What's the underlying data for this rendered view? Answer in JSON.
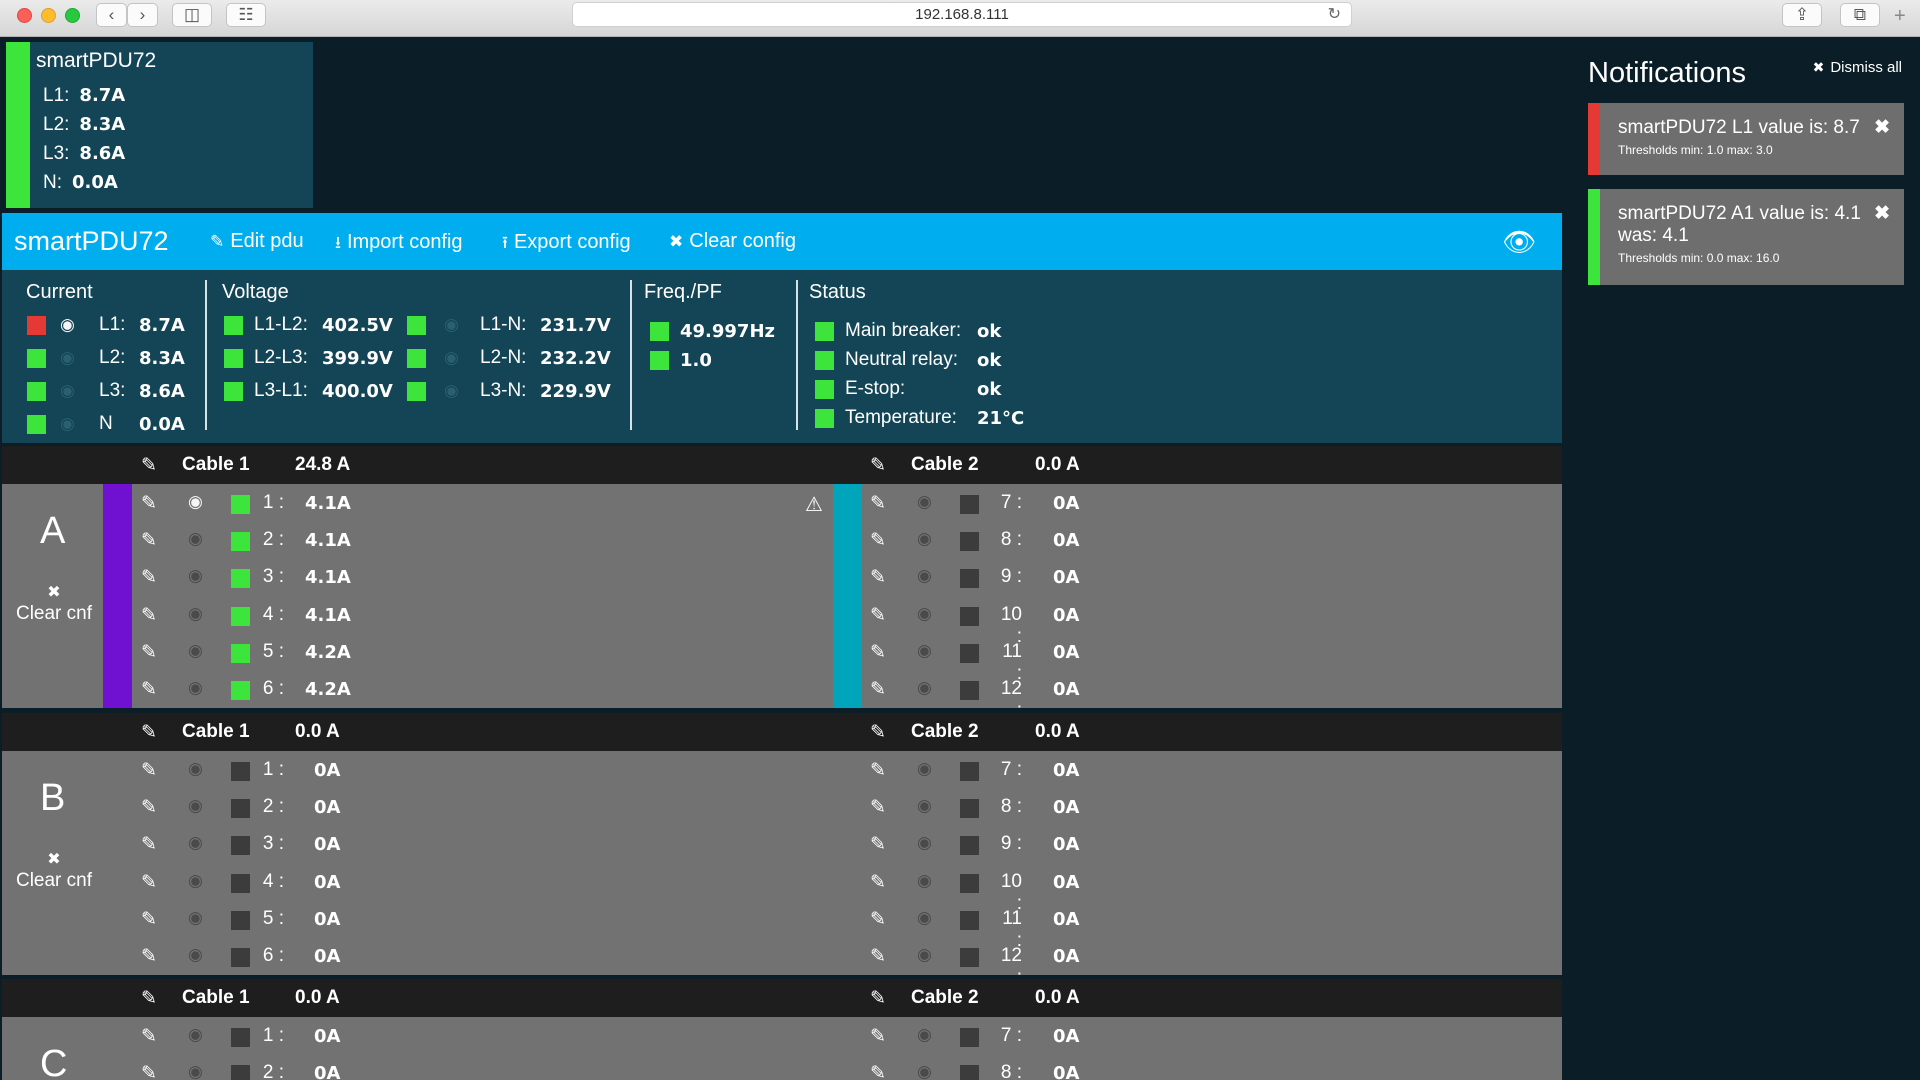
{
  "browser": {
    "url": "192.168.8.111",
    "nav_back_icon": "chevron-left-icon",
    "nav_forward_icon": "chevron-right-icon"
  },
  "mini_summary": {
    "title": "smartPDU72",
    "rows": [
      {
        "label": "L1:",
        "value": "8.7A"
      },
      {
        "label": "L2:",
        "value": "8.3A"
      },
      {
        "label": "L3:",
        "value": "8.6A"
      },
      {
        "label": "N:",
        "value": "0.0A"
      }
    ]
  },
  "header": {
    "pdu_name": "smartPDU72",
    "edit_pdu": "Edit pdu",
    "import_config": "Import config",
    "export_config": "Export config",
    "clear_config": "Clear config"
  },
  "metrics": {
    "current": {
      "heading": "Current",
      "rows": [
        {
          "label": "L1:",
          "value": "8.7A",
          "status": "red"
        },
        {
          "label": "L2:",
          "value": "8.3A",
          "status": "green"
        },
        {
          "label": "L3:",
          "value": "8.6A",
          "status": "green"
        },
        {
          "label": "N",
          "value": "0.0A",
          "status": "green"
        }
      ]
    },
    "voltage": {
      "heading": "Voltage",
      "line_to_line": [
        {
          "label": "L1-L2:",
          "value": "402.5V"
        },
        {
          "label": "L2-L3:",
          "value": "399.9V"
        },
        {
          "label": "L3-L1:",
          "value": "400.0V"
        }
      ],
      "line_to_neutral": [
        {
          "label": "L1-N:",
          "value": "231.7V"
        },
        {
          "label": "L2-N:",
          "value": "232.2V"
        },
        {
          "label": "L3-N:",
          "value": "229.9V"
        }
      ]
    },
    "freq_pf": {
      "heading": "Freq./PF",
      "frequency": "49.997Hz",
      "power_factor": "1.0"
    },
    "status": {
      "heading": "Status",
      "rows": [
        {
          "label": "Main breaker:",
          "value": "ok"
        },
        {
          "label": "Neutral relay:",
          "value": "ok"
        },
        {
          "label": "E-stop:",
          "value": "ok"
        },
        {
          "label": "Temperature:",
          "value": "21°C"
        }
      ]
    }
  },
  "segments": {
    "A": {
      "letter": "A",
      "clear_label": "Clear cnf",
      "cable1": {
        "label": "Cable 1",
        "value": "24.8 A",
        "stripe": "#7010d0"
      },
      "cable2": {
        "label": "Cable 2",
        "value": "0.0 A",
        "stripe": "#00a4bb"
      },
      "left": [
        {
          "num": "1 :",
          "value": "4.1A"
        },
        {
          "num": "2 :",
          "value": "4.1A"
        },
        {
          "num": "3 :",
          "value": "4.1A"
        },
        {
          "num": "4 :",
          "value": "4.1A"
        },
        {
          "num": "5 :",
          "value": "4.2A"
        },
        {
          "num": "6 :",
          "value": "4.2A"
        }
      ],
      "right": [
        {
          "num": "7 :",
          "value": "0A"
        },
        {
          "num": "8 :",
          "value": "0A"
        },
        {
          "num": "9 :",
          "value": "0A"
        },
        {
          "num": "10 :",
          "value": "0A"
        },
        {
          "num": "11 :",
          "value": "0A"
        },
        {
          "num": "12 :",
          "value": "0A"
        }
      ]
    },
    "B": {
      "letter": "B",
      "clear_label": "Clear cnf",
      "cable1": {
        "label": "Cable 1",
        "value": "0.0 A"
      },
      "cable2": {
        "label": "Cable 2",
        "value": "0.0 A"
      },
      "left": [
        {
          "num": "1 :",
          "value": "0A"
        },
        {
          "num": "2 :",
          "value": "0A"
        },
        {
          "num": "3 :",
          "value": "0A"
        },
        {
          "num": "4 :",
          "value": "0A"
        },
        {
          "num": "5 :",
          "value": "0A"
        },
        {
          "num": "6 :",
          "value": "0A"
        }
      ],
      "right": [
        {
          "num": "7 :",
          "value": "0A"
        },
        {
          "num": "8 :",
          "value": "0A"
        },
        {
          "num": "9 :",
          "value": "0A"
        },
        {
          "num": "10 :",
          "value": "0A"
        },
        {
          "num": "11 :",
          "value": "0A"
        },
        {
          "num": "12 :",
          "value": "0A"
        }
      ]
    },
    "C": {
      "letter": "C",
      "cable1": {
        "label": "Cable 1",
        "value": "0.0 A"
      },
      "cable2": {
        "label": "Cable 2",
        "value": "0.0 A"
      },
      "left": [
        {
          "num": "1 :",
          "value": "0A"
        },
        {
          "num": "2 :",
          "value": "0A"
        }
      ],
      "right": [
        {
          "num": "7 :",
          "value": "0A"
        },
        {
          "num": "8 :",
          "value": "0A"
        }
      ]
    }
  },
  "notifications": {
    "title": "Notifications",
    "dismiss_all": "Dismiss all",
    "items": [
      {
        "text": "smartPDU72 L1 value is: 8.7",
        "thresholds": "Thresholds min: 1.0 max: 3.0",
        "color": "#e53935"
      },
      {
        "text": "smartPDU72 A1 value is: 4.1 was: 4.1",
        "thresholds": "Thresholds min: 0.0 max: 16.0",
        "color": "#3ce43c"
      }
    ]
  },
  "colors": {
    "accent": "#00adef",
    "ok_green": "#3ce43c",
    "alert_red": "#e53935",
    "panel": "#134556",
    "background": "#0b1d26"
  }
}
